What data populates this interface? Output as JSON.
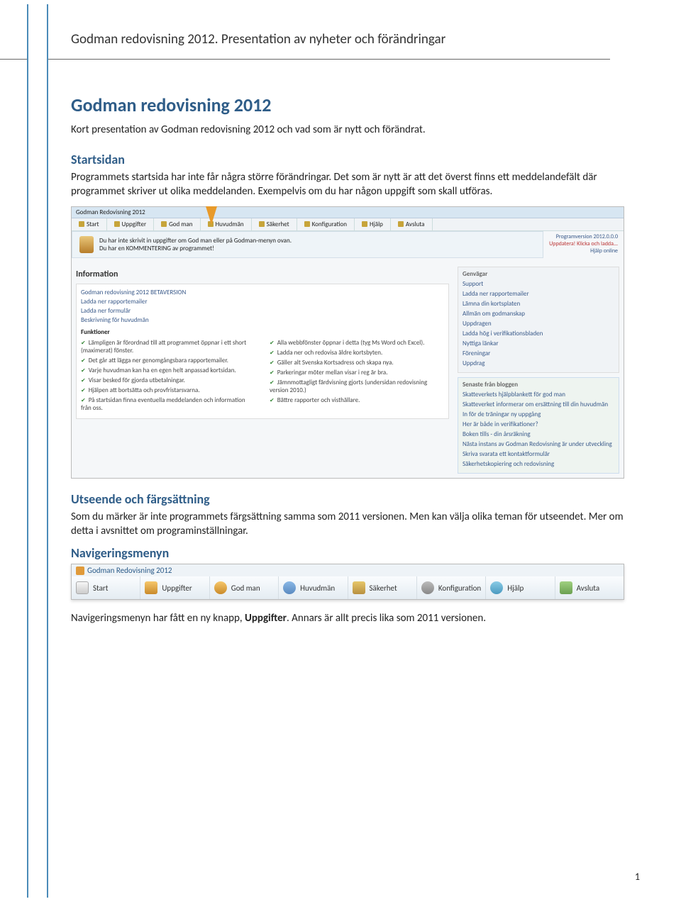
{
  "header": {
    "title": "Godman redovisning 2012. Presentation av  nyheter och förändringar"
  },
  "doc": {
    "title": "Godman redovisning 2012",
    "intro": "Kort presentation av Godman redovisning 2012 och vad som är nytt och förändrat.",
    "s1_heading": "Startsidan",
    "s1_body": "Programmets startsida har inte får några större förändringar. Det som är nytt är att det överst finns ett meddelandefält där programmet skriver ut olika meddelanden. Exempelvis om du har någon uppgift som skall utföras.",
    "s2_heading": "Utseende och färgsättning",
    "s2_body": "Som du märker är inte programmets färgsättning samma som 2011 versionen. Men kan välja olika teman för utseendet. Mer om detta i avsnittet om programinställningar.",
    "s3_heading": "Navigeringsmenyn",
    "nav_p1": "Navigeringsmenyn har fått en ny knapp, ",
    "nav_bold": "Uppgifter",
    "nav_p2": ". Annars är allt precis lika som 2011 versionen."
  },
  "shot1": {
    "window_title": "Godman Redovisning 2012",
    "toolbar": [
      "Start",
      "Uppgifter",
      "God man",
      "Huvudmän",
      "Säkerhet",
      "Konfiguration",
      "Hjälp",
      "Avsluta"
    ],
    "banner_lines": [
      "Du har inte skrivit in uppgifter om God man eller på Godman-menyn ovan.",
      "Du har en KOMMENTERING av programmet!"
    ],
    "top_links": {
      "ver": "Programversion 2012.0.0.0",
      "upd": "Uppdatera!   Klicka och ladda...",
      "help": "Hjälp online"
    },
    "info_heading": "Information",
    "info_lines": [
      "Godman redovisning 2012 BETAVERSION",
      "Ladda ner rapportemailer",
      "Ladda ner formulär",
      "Beskrivning för huvudmän"
    ],
    "funk_heading": "Funktioner",
    "funk_left": [
      "Lämpligen är förordnad till att programmet öppnar i ett short (maximerat) fönster.",
      "Det går att lägga ner genomgångsbara rapportemailer.",
      "Varje huvudman kan ha en egen helt anpassad kortsidan.",
      "Visar besked för gjorda utbetalningar.",
      "Hjälpen att bortsätta och provfristarsvarna.",
      "På startsidan finna eventuella meddelanden och information från oss."
    ],
    "funk_right": [
      "Alla webbfönster öppnar i detta (tyg Ms Word och Excel).",
      "Ladda ner och redovisa äldre kortsbyten.",
      "Gäller alt Svenska Kortsadress och skapa nya.",
      "Parkeringar möter mellan visar i reg är bra.",
      "Jämnmottagligt färdvisning gjorts (undersidan redovisning version 2010.)",
      "Bättre rapporter och visthällare."
    ],
    "side_header": "Genvägar",
    "side_items": [
      "Support",
      "Ladda ner rapportemailer",
      "Lämna din kortsplaten",
      "Allmän om godmanskap",
      "Uppdragen",
      "Ladda hög i verifikationsbladen",
      "Nyttiga länkar",
      "Föreningar",
      "Uppdrag"
    ],
    "blog_header": "Senaste från bloggen",
    "blog_items": [
      "Skatteverkets hjälpblankett för god man",
      "Skatteverket informerar om ersättning till din huvudmän",
      "In för de träningar ny uppgång",
      "Her är både in verifikationer?",
      "Boken tills - din årsräkning",
      "Nästa instans av Godman Redovisning är under utveckling",
      "Skriva svarata ett kontaktformulär",
      "Säkerhetskopiering och redovisning"
    ]
  },
  "shot2": {
    "title": "Godman Redovisning 2012",
    "items": [
      "Start",
      "Uppgifter",
      "God man",
      "Huvudmän",
      "Säkerhet",
      "Konfiguration",
      "Hjälp",
      "Avsluta"
    ]
  },
  "page_number": "1"
}
